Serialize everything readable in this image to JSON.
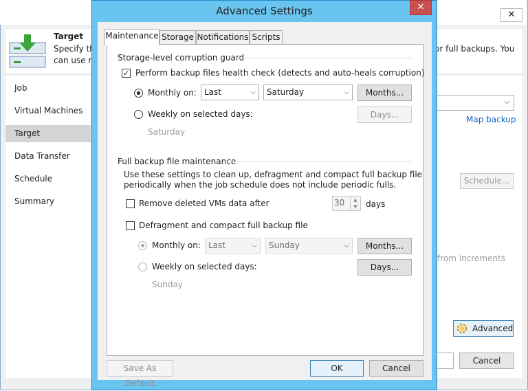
{
  "background_window": {
    "header": {
      "title": "Target",
      "line1": "Specify the",
      "line2": "can use m",
      "right_text": "or full backups. You"
    },
    "nav_items": [
      "Job",
      "Virtual Machines",
      "Target",
      "Data Transfer",
      "Schedule",
      "Summary"
    ],
    "selected_nav": "Target",
    "map_backup_link": "Map backup",
    "schedule_button": "Schedule...",
    "from_increments_text": "from increments",
    "advanced_button": "Advanced",
    "cancel_button": "Cancel",
    "close_glyph": "✕"
  },
  "dialog": {
    "title": "Advanced Settings",
    "close_glyph": "✕",
    "tabs": [
      "Maintenance",
      "Storage",
      "Notifications",
      "Scripts"
    ],
    "active_tab": "Maintenance",
    "corruption_guard": {
      "group_title": "Storage-level corruption guard",
      "health_check_label": "Perform backup files health check (detects and auto-heals corruption)",
      "health_check_checked": true,
      "monthly_label": "Monthly on:",
      "monthly_selected": true,
      "monthly_week": "Last",
      "monthly_day": "Saturday",
      "months_button": "Months...",
      "weekly_label": "Weekly on selected days:",
      "days_button": "Days...",
      "weekly_summary": "Saturday"
    },
    "full_backup_maintenance": {
      "group_title": "Full backup file maintenance",
      "description_line1": "Use these settings to clean up, defragment and compact full backup file",
      "description_line2": "periodically when the job schedule does not include periodic fulls.",
      "remove_deleted_label": "Remove deleted VMs data after",
      "remove_deleted_checked": false,
      "remove_deleted_days": "30",
      "days_unit": "days",
      "defragment_label": "Defragment and compact full backup file",
      "defragment_checked": false,
      "monthly_label": "Monthly on:",
      "monthly_week": "Last",
      "monthly_day": "Sunday",
      "months_button": "Months...",
      "weekly_label": "Weekly on selected days:",
      "days_button": "Days...",
      "weekly_summary": "Sunday"
    },
    "footer": {
      "save_default_button": "Save As Default",
      "ok_button": "OK",
      "cancel_button": "Cancel"
    }
  },
  "colors": {
    "dialog_frame": "#6ac4f0",
    "close_button": "#c75050",
    "link": "#0a66c2"
  }
}
